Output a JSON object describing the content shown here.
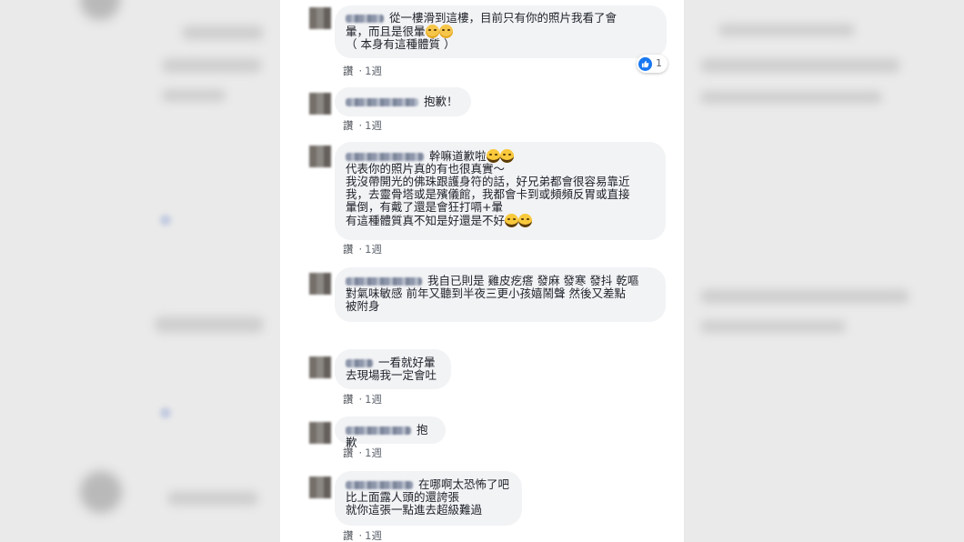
{
  "comments": [
    {
      "lines": [
        "從一樓滑到這樓，目前只有你的照片我看了會",
        "暈，而且是很暈",
        "（ 本身有這種體質 ）"
      ],
      "like": "讚",
      "time": "1週",
      "reaction_count": "1"
    },
    {
      "lines": [
        "抱歉！"
      ],
      "like": "讚",
      "time": "1週"
    },
    {
      "lines": [
        "幹嘛道歉啦",
        "代表你的照片真的有也很真實～",
        "我沒帶開光的佛珠跟護身符的話，好兄弟都會很容易靠近",
        "我，去靈骨塔或是殯儀館，我都會卡到或頻頻反胃或直接",
        "暈倒，有戴了還是會狂打嗝+暈",
        "有這種體質真不知是好還是不好"
      ],
      "like": "讚",
      "time": "1週"
    },
    {
      "lines": [
        "我自已則是 雞皮疙瘩 發麻 發寒 發抖 乾嘔",
        "對氣味敏感 前年又聽到半夜三更小孩嬉鬧聲 然後又差點",
        "被附身"
      ],
      "like": "讚",
      "time": "1週"
    },
    {
      "lines": [
        "一看就好暈",
        "去現場我一定會吐"
      ],
      "like": "讚",
      "time": "1週"
    },
    {
      "lines": [
        "抱歉"
      ],
      "like": "讚",
      "time": "1週"
    },
    {
      "lines": [
        "在哪啊太恐怖了吧",
        "比上面露人頭的還誇張",
        "就你這張一點進去超級難過"
      ],
      "like": "讚",
      "time": "1週"
    }
  ],
  "icons": {
    "reaction": "like-thumb-icon",
    "emoji_sad": "sad-face-emoji-icon",
    "emoji_laugh": "laughing-face-emoji-icon"
  },
  "colors": {
    "bubble_bg": "#f2f3f5",
    "meta_text": "#606770",
    "reaction_blue": "#1877f2"
  }
}
